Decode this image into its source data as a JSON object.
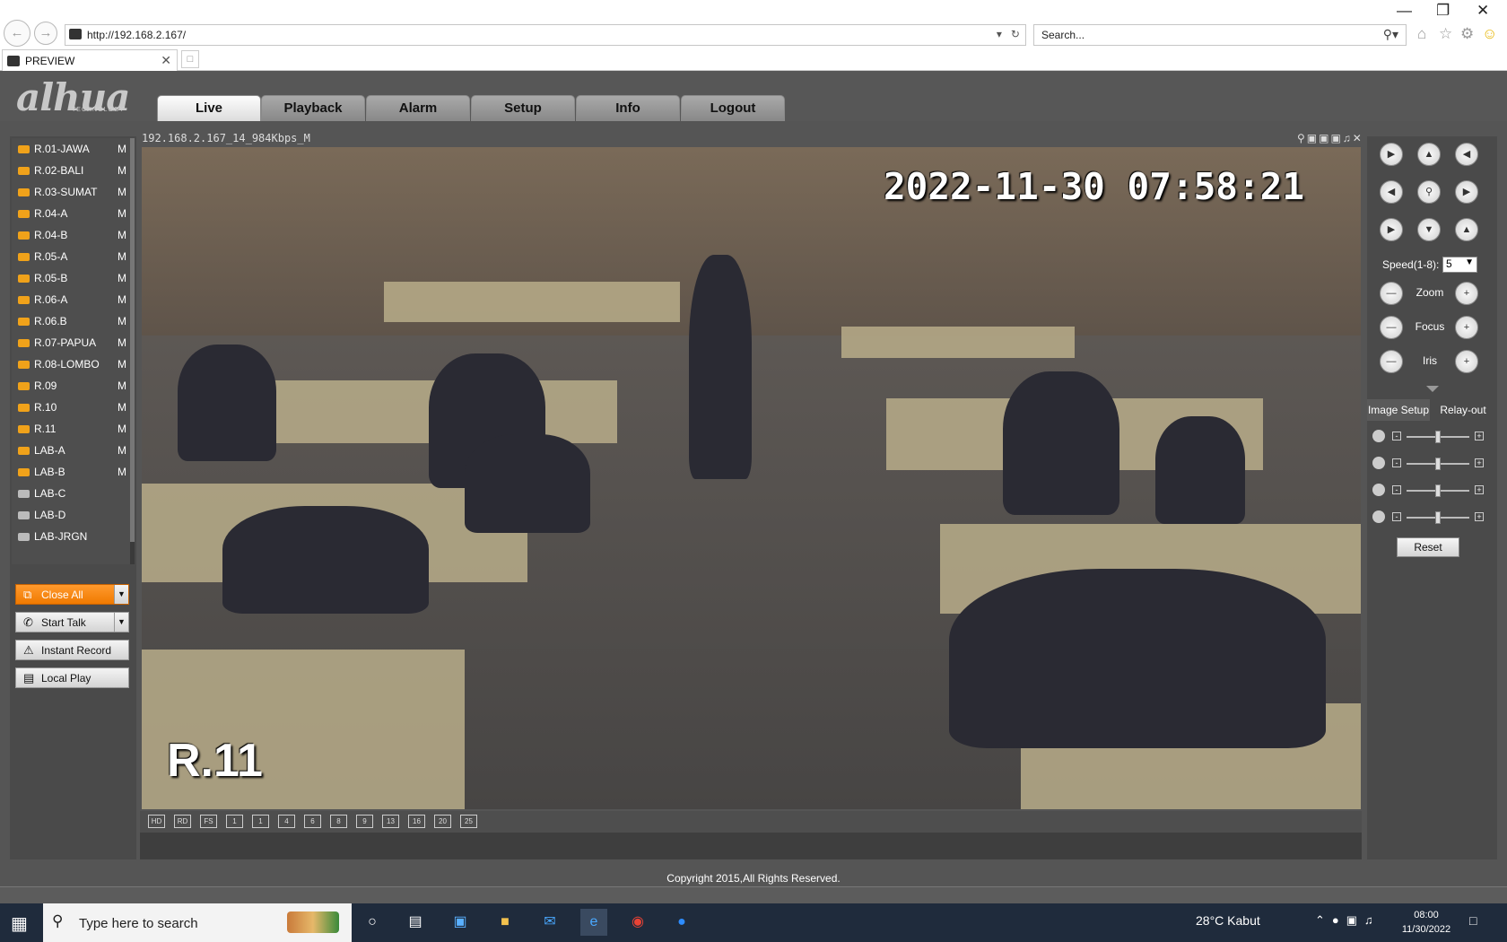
{
  "browser": {
    "url": "http://192.168.2.167/",
    "search_placeholder": "Search...",
    "tab_title": "PREVIEW"
  },
  "nav": {
    "tabs": [
      {
        "label": "Live",
        "active": true
      },
      {
        "label": "Playback"
      },
      {
        "label": "Alarm"
      },
      {
        "label": "Setup"
      },
      {
        "label": "Info"
      },
      {
        "label": "Logout"
      }
    ]
  },
  "logo": {
    "text": "alhua",
    "sub": "TECHNOLOGY"
  },
  "cameras": [
    {
      "label": "R.01-JAWA",
      "mode": "M",
      "online": true
    },
    {
      "label": "R.02-BALI",
      "mode": "M",
      "online": true
    },
    {
      "label": "R.03-SUMAT",
      "mode": "M",
      "online": true
    },
    {
      "label": "R.04-A",
      "mode": "M",
      "online": true
    },
    {
      "label": "R.04-B",
      "mode": "M",
      "online": true
    },
    {
      "label": "R.05-A",
      "mode": "M",
      "online": true
    },
    {
      "label": "R.05-B",
      "mode": "M",
      "online": true
    },
    {
      "label": "R.06-A",
      "mode": "M",
      "online": true
    },
    {
      "label": "R.06.B",
      "mode": "M",
      "online": true
    },
    {
      "label": "R.07-PAPUA",
      "mode": "M",
      "online": true
    },
    {
      "label": "R.08-LOMBO",
      "mode": "M",
      "online": true
    },
    {
      "label": "R.09",
      "mode": "M",
      "online": true
    },
    {
      "label": "R.10",
      "mode": "M",
      "online": true
    },
    {
      "label": "R.11",
      "mode": "M",
      "online": true
    },
    {
      "label": "LAB-A",
      "mode": "M",
      "online": true
    },
    {
      "label": "LAB-B",
      "mode": "M",
      "online": true
    },
    {
      "label": "LAB-C",
      "mode": "",
      "online": false
    },
    {
      "label": "LAB-D",
      "mode": "",
      "online": false
    },
    {
      "label": "LAB-JRGN",
      "mode": "",
      "online": false
    }
  ],
  "actions": {
    "close_all": "Close All",
    "start_talk": "Start Talk",
    "instant_record": "Instant Record",
    "local_play": "Local Play"
  },
  "video": {
    "title": "192.168.2.167_14_984Kbps_M",
    "osd_time": "2022-11-30 07:58:21",
    "osd_name": "R.11"
  },
  "layouts": [
    "HD",
    "RD",
    "FS",
    "1",
    "1",
    "4",
    "6",
    "8",
    "9",
    "13",
    "16",
    "20",
    "25"
  ],
  "ptz": {
    "speed_label": "Speed(1-8):",
    "speed_value": "5",
    "zoom": "Zoom",
    "focus": "Focus",
    "iris": "Iris",
    "tab_image": "Image Setup",
    "tab_relay": "Relay-out",
    "sliders": [
      {
        "name": "brightness",
        "value": 0.5
      },
      {
        "name": "contrast",
        "value": 0.5
      },
      {
        "name": "saturation",
        "value": 0.5
      },
      {
        "name": "hue",
        "value": 0.5
      }
    ],
    "reset": "Reset"
  },
  "footer": {
    "copyright": "Copyright 2015,All Rights Reserved."
  },
  "taskbar": {
    "search_placeholder": "Type here to search",
    "weather": "28°C  Kabut",
    "time": "08:00",
    "date": "11/30/2022"
  }
}
